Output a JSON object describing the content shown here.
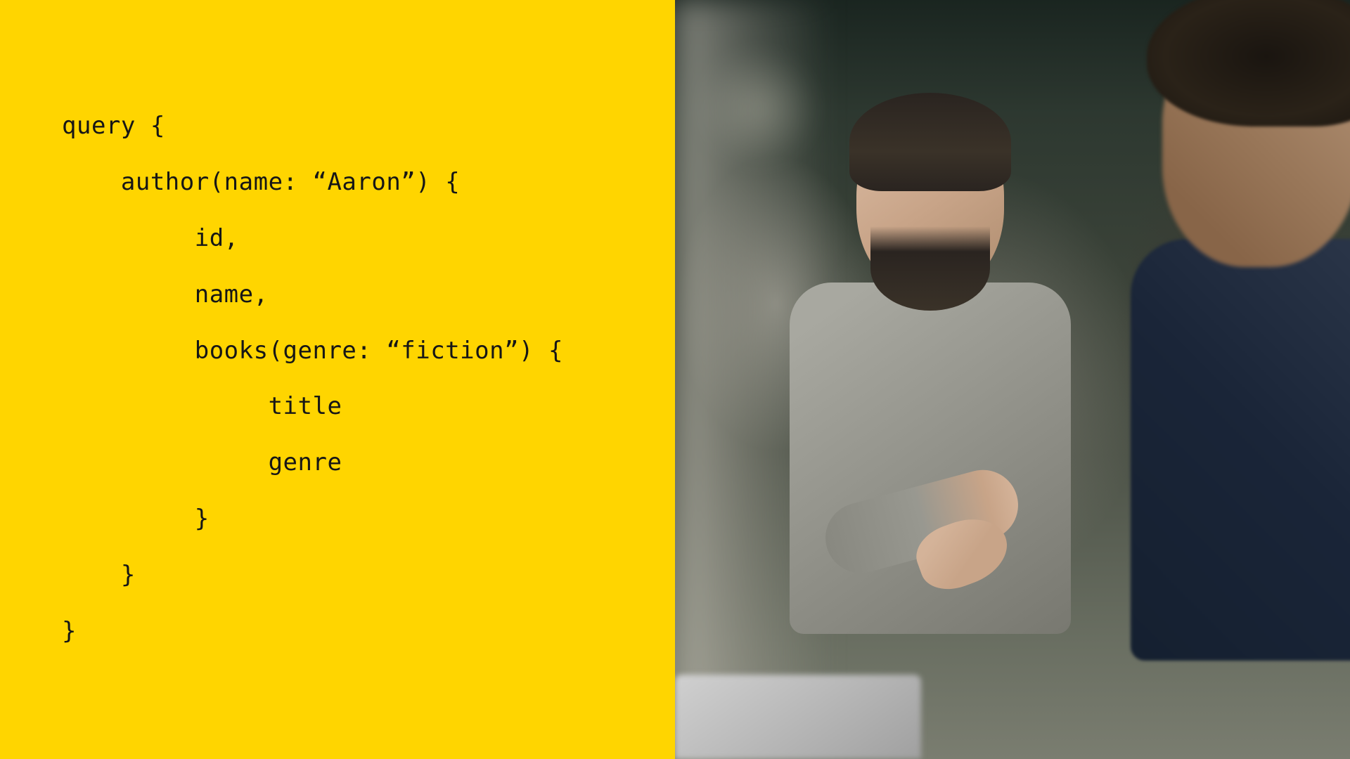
{
  "code": {
    "line1": "query {",
    "line2": "    author(name: “Aaron”) {",
    "line3": "         id,",
    "line4": "         name,",
    "line5": "         books(genre: “fiction”) {",
    "line6": "              title",
    "line7": "              genre",
    "line8": "         }",
    "line9": "    }",
    "line10": "}"
  },
  "colors": {
    "panel_bg": "#ffd500",
    "code_text": "#161616"
  }
}
